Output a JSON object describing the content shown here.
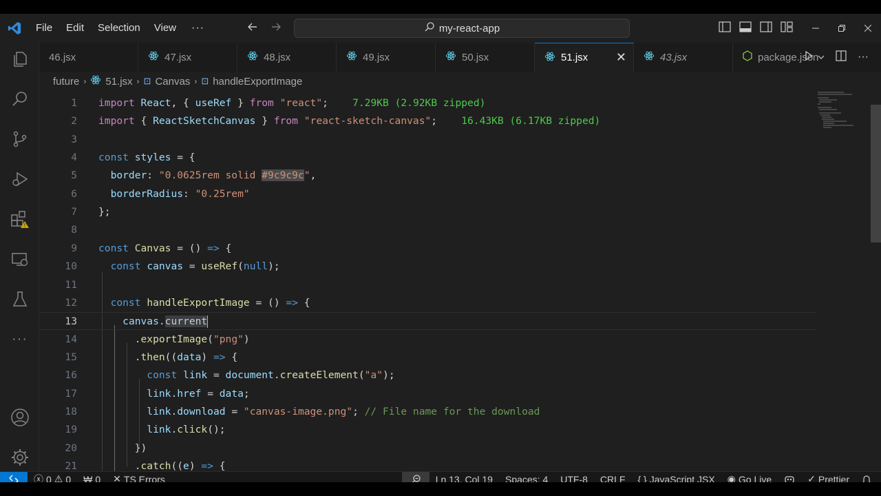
{
  "menu": [
    "File",
    "Edit",
    "Selection",
    "View"
  ],
  "menu_more": "···",
  "command_center": {
    "text": "my-react-app"
  },
  "tabs": [
    {
      "label": "46.jsx",
      "active": false,
      "italic": false
    },
    {
      "label": "47.jsx",
      "active": false,
      "italic": false
    },
    {
      "label": "48.jsx",
      "active": false,
      "italic": false
    },
    {
      "label": "49.jsx",
      "active": false,
      "italic": false
    },
    {
      "label": "50.jsx",
      "active": false,
      "italic": false
    },
    {
      "label": "51.jsx",
      "active": true,
      "italic": false
    },
    {
      "label": "43.jsx",
      "active": false,
      "italic": true
    },
    {
      "label": "package.json",
      "active": false,
      "italic": false
    }
  ],
  "breadcrumb": {
    "folder": "future",
    "file": "51.jsx",
    "component": "Canvas",
    "func": "handleExportImage"
  },
  "code_lines": [
    {
      "n": "1",
      "tokens": [
        [
          "kw",
          "import"
        ],
        [
          "pl",
          " "
        ],
        [
          "var",
          "React"
        ],
        [
          "pl",
          ", { "
        ],
        [
          "var",
          "useRef"
        ],
        [
          "pl",
          " } "
        ],
        [
          "kw",
          "from"
        ],
        [
          "pl",
          " "
        ],
        [
          "str",
          "\"react\""
        ],
        [
          "pl",
          ";    "
        ],
        [
          "size",
          "7.29KB (2.92KB zipped)"
        ]
      ]
    },
    {
      "n": "2",
      "tokens": [
        [
          "kw",
          "import"
        ],
        [
          "pl",
          " { "
        ],
        [
          "var",
          "ReactSketchCanvas"
        ],
        [
          "pl",
          " } "
        ],
        [
          "kw",
          "from"
        ],
        [
          "pl",
          " "
        ],
        [
          "str",
          "\"react-sketch-canvas\""
        ],
        [
          "pl",
          ";    "
        ],
        [
          "size",
          "16.43KB (6.17KB zipped)"
        ]
      ]
    },
    {
      "n": "3",
      "tokens": []
    },
    {
      "n": "4",
      "tokens": [
        [
          "kw2",
          "const"
        ],
        [
          "pl",
          " "
        ],
        [
          "var",
          "styles"
        ],
        [
          "pl",
          " = {"
        ]
      ]
    },
    {
      "n": "5",
      "tokens": [
        [
          "pl",
          "  "
        ],
        [
          "var",
          "border"
        ],
        [
          "pl",
          ": "
        ],
        [
          "str",
          "\"0.0625rem solid "
        ],
        [
          "hl",
          "#9c9c9c"
        ],
        [
          "str",
          "\""
        ],
        [
          "pl",
          ","
        ]
      ]
    },
    {
      "n": "6",
      "tokens": [
        [
          "pl",
          "  "
        ],
        [
          "var",
          "borderRadius"
        ],
        [
          "pl",
          ": "
        ],
        [
          "str",
          "\"0.25rem\""
        ]
      ]
    },
    {
      "n": "7",
      "tokens": [
        [
          "pl",
          "};"
        ]
      ]
    },
    {
      "n": "8",
      "tokens": []
    },
    {
      "n": "9",
      "tokens": [
        [
          "kw2",
          "const"
        ],
        [
          "pl",
          " "
        ],
        [
          "fn",
          "Canvas"
        ],
        [
          "pl",
          " = () "
        ],
        [
          "kw2",
          "=>"
        ],
        [
          "pl",
          " {"
        ]
      ]
    },
    {
      "n": "10",
      "tokens": [
        [
          "pl",
          "  "
        ],
        [
          "kw2",
          "const"
        ],
        [
          "pl",
          " "
        ],
        [
          "var",
          "canvas"
        ],
        [
          "pl",
          " = "
        ],
        [
          "fn",
          "useRef"
        ],
        [
          "pl",
          "("
        ],
        [
          "kw2",
          "null"
        ],
        [
          "pl",
          ");"
        ]
      ]
    },
    {
      "n": "11",
      "tokens": []
    },
    {
      "n": "12",
      "tokens": [
        [
          "pl",
          "  "
        ],
        [
          "kw2",
          "const"
        ],
        [
          "pl",
          " "
        ],
        [
          "fn",
          "handleExportImage"
        ],
        [
          "pl",
          " = () "
        ],
        [
          "kw2",
          "=>"
        ],
        [
          "pl",
          " {"
        ]
      ]
    },
    {
      "n": "13",
      "tokens": [
        [
          "pl",
          "    "
        ],
        [
          "var",
          "canvas"
        ],
        [
          "pl",
          "."
        ],
        [
          "selw",
          "current"
        ]
      ]
    },
    {
      "n": "14",
      "tokens": [
        [
          "pl",
          "      ."
        ],
        [
          "fn",
          "exportImage"
        ],
        [
          "pl",
          "("
        ],
        [
          "str",
          "\"png\""
        ],
        [
          "pl",
          ")"
        ]
      ]
    },
    {
      "n": "15",
      "tokens": [
        [
          "pl",
          "      ."
        ],
        [
          "fn",
          "then"
        ],
        [
          "pl",
          "(("
        ],
        [
          "var",
          "data"
        ],
        [
          "pl",
          ") "
        ],
        [
          "kw2",
          "=>"
        ],
        [
          "pl",
          " {"
        ]
      ]
    },
    {
      "n": "16",
      "tokens": [
        [
          "pl",
          "        "
        ],
        [
          "kw2",
          "const"
        ],
        [
          "pl",
          " "
        ],
        [
          "var",
          "link"
        ],
        [
          "pl",
          " = "
        ],
        [
          "var",
          "document"
        ],
        [
          "pl",
          "."
        ],
        [
          "fn",
          "createElement"
        ],
        [
          "pl",
          "("
        ],
        [
          "str",
          "\"a\""
        ],
        [
          "pl",
          ");"
        ]
      ]
    },
    {
      "n": "17",
      "tokens": [
        [
          "pl",
          "        "
        ],
        [
          "var",
          "link"
        ],
        [
          "pl",
          "."
        ],
        [
          "var",
          "href"
        ],
        [
          "pl",
          " = "
        ],
        [
          "var",
          "data"
        ],
        [
          "pl",
          ";"
        ]
      ]
    },
    {
      "n": "18",
      "tokens": [
        [
          "pl",
          "        "
        ],
        [
          "var",
          "link"
        ],
        [
          "pl",
          "."
        ],
        [
          "var",
          "download"
        ],
        [
          "pl",
          " = "
        ],
        [
          "str",
          "\"canvas-image.png\""
        ],
        [
          "pl",
          "; "
        ],
        [
          "cmt",
          "// File name for the download"
        ]
      ]
    },
    {
      "n": "19",
      "tokens": [
        [
          "pl",
          "        "
        ],
        [
          "var",
          "link"
        ],
        [
          "pl",
          "."
        ],
        [
          "fn",
          "click"
        ],
        [
          "pl",
          "();"
        ]
      ]
    },
    {
      "n": "20",
      "tokens": [
        [
          "pl",
          "      })"
        ]
      ]
    },
    {
      "n": "21",
      "tokens": [
        [
          "pl",
          "      ."
        ],
        [
          "fn",
          "catch"
        ],
        [
          "pl",
          "(("
        ],
        [
          "var",
          "e"
        ],
        [
          "pl",
          ") "
        ],
        [
          "kw2",
          "=>"
        ],
        [
          "pl",
          " {"
        ]
      ]
    }
  ],
  "current_line": "13",
  "status": {
    "errors": "0",
    "warnings": "0",
    "ports": "0",
    "ts_errors": "TS Errors",
    "position": "Ln 13, Col 19",
    "spaces": "Spaces: 4",
    "encoding": "UTF-8",
    "eol": "CRLF",
    "language": "JavaScript JSX",
    "golive": "Go Live",
    "prettier": "Prettier",
    "lang_braces": "{ }"
  },
  "colors": {
    "accent": "#0078d4",
    "react": "#61dafb",
    "warning": "#cca700"
  }
}
